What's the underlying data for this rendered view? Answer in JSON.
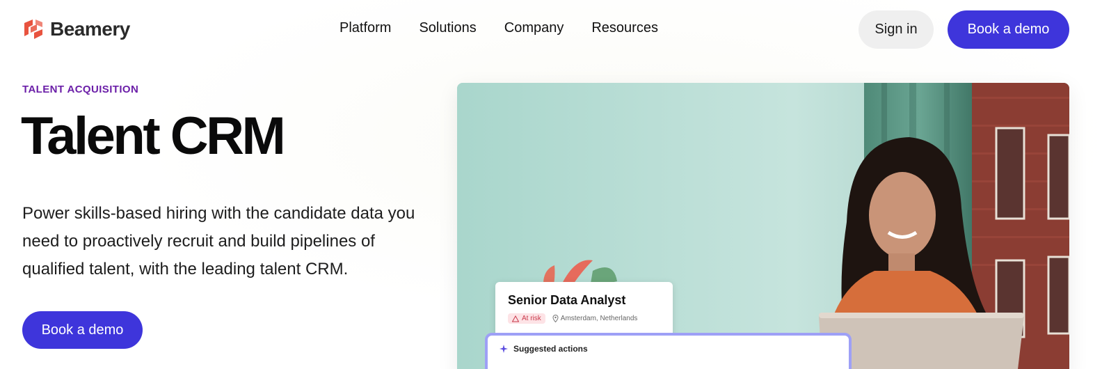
{
  "brand": {
    "name": "Beamery",
    "color": "#e8533f"
  },
  "nav": {
    "items": [
      "Platform",
      "Solutions",
      "Company",
      "Resources"
    ],
    "sign_in": "Sign in",
    "book_demo": "Book a demo"
  },
  "hero": {
    "eyebrow": "TALENT ACQUISITION",
    "title": "Talent CRM",
    "description": "Power skills-based hiring with the candidate data you need to proactively recruit and build pipelines of qualified talent, with the leading talent CRM.",
    "cta": "Book a demo"
  },
  "job_card": {
    "title": "Senior Data Analyst",
    "badge": "At risk",
    "location": "Amsterdam, Netherlands"
  },
  "actions_card": {
    "title": "Suggested actions"
  },
  "colors": {
    "accent": "#3e35db",
    "eyebrow": "#6b1fa8",
    "badge_bg": "#fde3e6",
    "badge_text": "#c8384a"
  }
}
